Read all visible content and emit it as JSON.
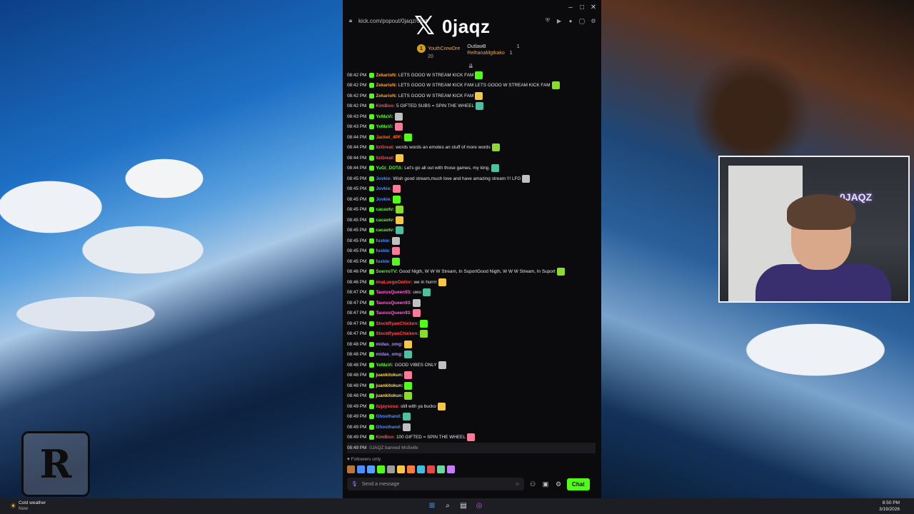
{
  "popout": {
    "url": "kick.com/popout/0jaqz/chat",
    "stream_title_icon": "x-logo-icon",
    "stream_name": "0jaqz",
    "leaderboard": [
      {
        "name": "YouthCrewDre",
        "count": "20"
      },
      {
        "name": "OutlawB",
        "count": "1"
      },
      {
        "name": "ReihanaMgtkako",
        "count": "1"
      }
    ]
  },
  "chat": [
    {
      "ts": "08:42 PM",
      "user": "ZekarioN:",
      "text": "LETS GOOO W STREAM KICK FAM",
      "color": "#f0a640"
    },
    {
      "ts": "08:42 PM",
      "user": "ZekarioN:",
      "text": "LETS GOOO W STREAM KICK FAM  LETS GOOO W STREAM KICK FAM",
      "color": "#f0a640"
    },
    {
      "ts": "08:42 PM",
      "user": "ZekarioN:",
      "text": "LETS GOOO W STREAM KICK FAM",
      "color": "#f0a640"
    },
    {
      "ts": "08:42 PM",
      "user": "KimBoo:",
      "text": "5 GIFTED SUBS = SPIN THE WHEEL",
      "color": "#ff4d4d"
    },
    {
      "ts": "08:43 PM",
      "user": "YeMaVi:",
      "text": "",
      "color": "#53fc18"
    },
    {
      "ts": "08:43 PM",
      "user": "YeMaVi:",
      "text": "",
      "color": "#53fc18"
    },
    {
      "ts": "08:44 PM",
      "user": "Jacket_4PF:",
      "text": "",
      "color": "#ff6f00"
    },
    {
      "ts": "08:44 PM",
      "user": "itzGreat:",
      "text": "words words an emotes an stuff of more words",
      "color": "#ff4d4d"
    },
    {
      "ts": "08:44 PM",
      "user": "itzGreat:",
      "text": "",
      "color": "#ff4d4d"
    },
    {
      "ts": "08:44 PM",
      "user": "YuGi_DOTA:",
      "text": "Let's go all out with those games, my king.",
      "color": "#53fc18"
    },
    {
      "ts": "08:45 PM",
      "user": "Jovkie:",
      "text": "Wish good stream,much love and have amazing stream !!! LFG",
      "color": "#4d8dff"
    },
    {
      "ts": "08:45 PM",
      "user": "Jovkie:",
      "text": "",
      "color": "#4d8dff"
    },
    {
      "ts": "08:45 PM",
      "user": "Jovkie:",
      "text": "",
      "color": "#4d8dff"
    },
    {
      "ts": "08:45 PM",
      "user": "cacaotv:",
      "text": "",
      "color": "#53fc18"
    },
    {
      "ts": "08:45 PM",
      "user": "cacaotv:",
      "text": "",
      "color": "#53fc18"
    },
    {
      "ts": "08:45 PM",
      "user": "cacaotv:",
      "text": "",
      "color": "#53fc18"
    },
    {
      "ts": "08:45 PM",
      "user": "fuskie:",
      "text": "",
      "color": "#4d8dff"
    },
    {
      "ts": "08:45 PM",
      "user": "fuskie:",
      "text": "",
      "color": "#4d8dff"
    },
    {
      "ts": "08:45 PM",
      "user": "fuskie:",
      "text": "",
      "color": "#4d8dff"
    },
    {
      "ts": "08:46 PM",
      "user": "SoerroTV:",
      "text": "Good Nigth, W W W Stream, In SuportGood Nigth, W W W Stream, In Suport",
      "color": "#53fc18"
    },
    {
      "ts": "08:46 PM",
      "user": "imaLuegoOnlinr:",
      "text": "we in hurrrr",
      "color": "#ff4d4d"
    },
    {
      "ts": "08:47 PM",
      "user": "TaurusQueen93:",
      "text": "uwu",
      "color": "#ff5fd2"
    },
    {
      "ts": "08:47 PM",
      "user": "TaurusQueen93:",
      "text": "",
      "color": "#ff5fd2"
    },
    {
      "ts": "08:47 PM",
      "user": "TaurusQueen93:",
      "text": "",
      "color": "#ff5fd2"
    },
    {
      "ts": "08:47 PM",
      "user": "StockRyanChicken:",
      "text": "",
      "color": "#ff4d4d"
    },
    {
      "ts": "08:47 PM",
      "user": "StockRyanChicken:",
      "text": "",
      "color": "#ff4d4d"
    },
    {
      "ts": "08:48 PM",
      "user": "midas_omg:",
      "text": "",
      "color": "#a58bff"
    },
    {
      "ts": "08:48 PM",
      "user": "midas_omg:",
      "text": "",
      "color": "#a58bff"
    },
    {
      "ts": "08:48 PM",
      "user": "YeMaVi:",
      "text": "GOOD VIBES ONLY",
      "color": "#53fc18"
    },
    {
      "ts": "08:48 PM",
      "user": "juankitokun:",
      "text": "",
      "color": "#ffd84d"
    },
    {
      "ts": "08:48 PM",
      "user": "juankitokun:",
      "text": "",
      "color": "#ffd84d"
    },
    {
      "ts": "08:48 PM",
      "user": "juankitokun:",
      "text": "",
      "color": "#ffd84d"
    },
    {
      "ts": "08:49 PM",
      "user": "itzjaysosa:",
      "text": "still with ya bucko",
      "color": "#ff4d4d"
    },
    {
      "ts": "08:49 PM",
      "user": "Ghosthand:",
      "text": "",
      "color": "#4d8dff"
    },
    {
      "ts": "08:49 PM",
      "user": "Ghosthand:",
      "text": "",
      "color": "#4d8dff"
    },
    {
      "ts": "08:49 PM",
      "user": "KimBoo:",
      "text": "100 GIFTED = SPIN THE WHEEL",
      "color": "#ff4d4d"
    }
  ],
  "system_message": {
    "ts": "08:49 PM",
    "text": "0JAQZ banned Ms5wife"
  },
  "followers_only": "Followers only",
  "input": {
    "placeholder": "Send a message",
    "chat_button": "Chat"
  },
  "webcam_label": "0JAQZ",
  "taskbar": {
    "weather_title": "Cold weather",
    "weather_sub": "Now",
    "time": "8:50 PM",
    "date": "3/19/2026"
  }
}
